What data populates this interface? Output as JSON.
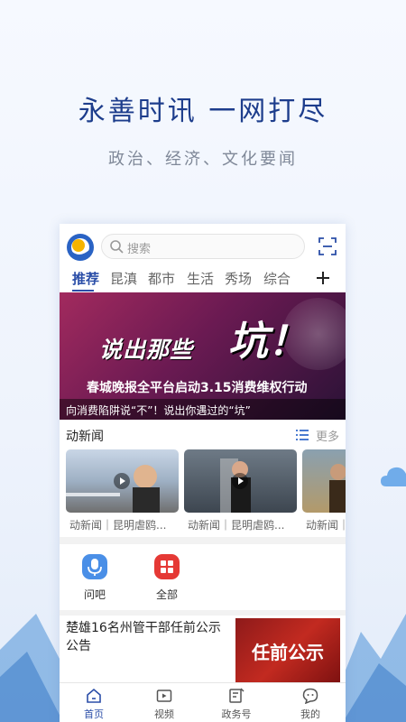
{
  "promo": {
    "headline": "永善时讯  一网打尽",
    "subline": "政治、经济、文化要闻"
  },
  "app": {
    "search_placeholder": "搜索",
    "tabs": [
      {
        "label": "推荐",
        "active": true
      },
      {
        "label": "昆滇",
        "active": false
      },
      {
        "label": "都市",
        "active": false
      },
      {
        "label": "生活",
        "active": false
      },
      {
        "label": "秀场",
        "active": false
      },
      {
        "label": "综合",
        "active": false
      }
    ],
    "banner": {
      "title_small": "说出那些",
      "title_big": "坑！",
      "subtitle": "春城晚报全平台启动3.15消费维权行动",
      "caption": "向消费陷阱说“不”！说出你遇过的“坑”"
    },
    "section": {
      "title": "动新闻",
      "more": "更多"
    },
    "videos": [
      {
        "caption": "动新闻｜昆明虐鸥..."
      },
      {
        "caption": "动新闻｜昆明虐鸥..."
      },
      {
        "caption": "动新闻｜"
      }
    ],
    "quick": [
      {
        "label": "问吧",
        "icon": "microphone-icon",
        "color": "#4a8fe7"
      },
      {
        "label": "全部",
        "icon": "grid-icon",
        "color": "#e53935"
      }
    ],
    "article": {
      "title": "楚雄16名州管干部任前公示公告",
      "thumb_text": "任前公示"
    },
    "nav": [
      {
        "label": "首页",
        "icon": "home-icon",
        "active": true
      },
      {
        "label": "视频",
        "icon": "video-icon",
        "active": false
      },
      {
        "label": "政务号",
        "icon": "government-icon",
        "active": false
      },
      {
        "label": "我的",
        "icon": "profile-icon",
        "active": false
      }
    ]
  },
  "colors": {
    "brand": "#2b4ea8",
    "headline": "#1d3d8c",
    "accent_red": "#e53935"
  }
}
